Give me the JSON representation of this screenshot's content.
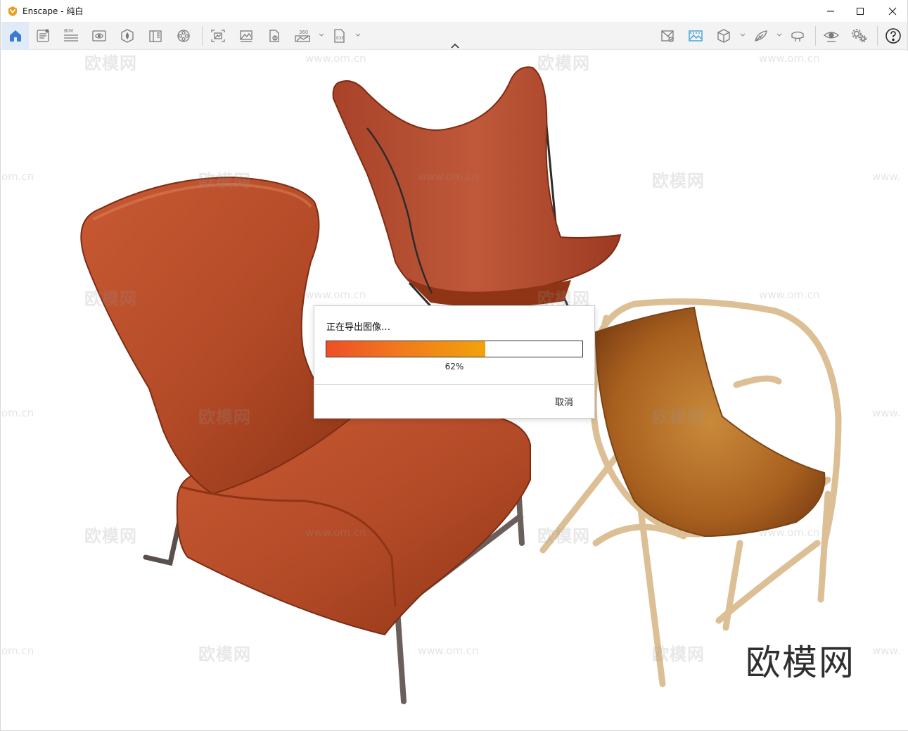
{
  "window": {
    "title": "Enscape - 纯白",
    "controls": [
      "minimize-icon",
      "maximize-icon",
      "close-icon"
    ]
  },
  "toolbar": {
    "left_icons": [
      "home-icon",
      "notes-icon",
      "bim-icon",
      "views-icon",
      "asset-library-icon",
      "material-editor-icon",
      "video-editor-icon",
      "screenshot-icon",
      "batch-render-icon",
      "panorama-icon",
      "360-export-icon",
      "exe-export-icon"
    ],
    "bim_label": "BIM",
    "pano_label": "360",
    "exe_label": "EXE",
    "right_icons": [
      "sync-view-icon",
      "render-image-icon",
      "orthographic-icon",
      "material-sun-icon",
      "vr-headset-icon",
      "view-settings-icon",
      "settings-icon",
      "help-icon"
    ],
    "active": "home-icon"
  },
  "watermark": {
    "text": "欧模网",
    "url": "www.om.cn",
    "url_partial_left": "om.cn",
    "url_partial_right": "www.",
    "brand": "欧模网"
  },
  "dialog": {
    "title": "正在导出图像…",
    "progress": 0.62,
    "progress_label": "62%",
    "cancel_label": "取消"
  },
  "colors": {
    "accent": "#3a7bd5",
    "progress_start": "#ee4f27",
    "progress_end": "#f2a20b",
    "leather": "#b84e2c",
    "wood": "#dcbf94"
  }
}
